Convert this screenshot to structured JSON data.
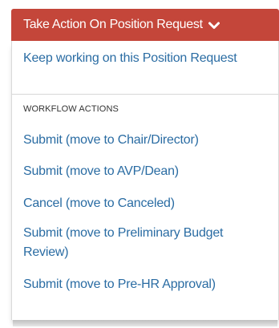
{
  "button": {
    "label": "Take Action On Position Request",
    "caret_icon": "chevron-down-icon",
    "color": "#c4463a"
  },
  "menu": {
    "keep_working": "Keep working on this Position Request",
    "section_header": "WORKFLOW ACTIONS",
    "actions": [
      "Submit (move to Chair/Director)",
      "Submit (move to AVP/Dean)",
      "Cancel (move to Canceled)",
      "Submit (move to Preliminary Budget Review)",
      "Submit (move to Pre-HR Approval)"
    ],
    "link_color": "#2a6ca3"
  }
}
